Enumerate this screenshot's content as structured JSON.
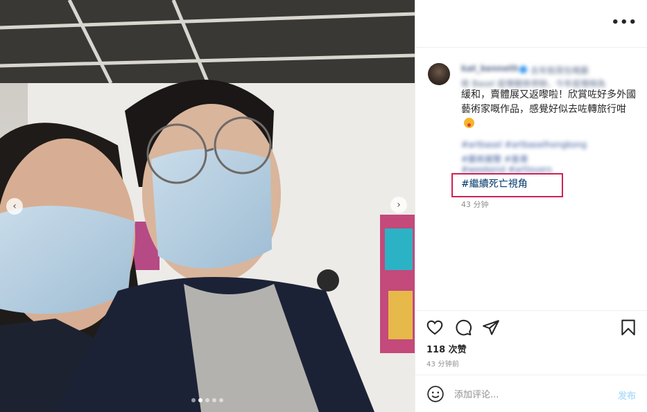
{
  "post": {
    "username": "kat_kenneth",
    "caption_blur_1": "去年既荷包嘅藝",
    "caption_blur_2": "術 Basel 疫情關係停辦，今年疫情稍為",
    "caption_main": "緩和，賣體展又返嚟啦！欣賞咗好多外國藝術家嘅作品，感覺好似去咗轉旅行咁",
    "emoji": "face-with-tongue-icon",
    "tags_blur_1": "#artbasel #artbaselhongkong",
    "tags_blur_2": "#藝術展覽 #香港",
    "tags_blur_3": "#weekend #artlovers",
    "hashtag": "#繼續死亡視角",
    "caption_time": "43 分钟",
    "likes": "118 次赞",
    "post_time": "43 分钟前",
    "more_label": "•••"
  },
  "carousel": {
    "dot_count": 5,
    "active_index": 1,
    "prev_label": "‹",
    "next_label": "›"
  },
  "comment": {
    "placeholder": "添加评论...",
    "post_label": "发布"
  },
  "colors": {
    "highlight": "#d11f55",
    "link": "#00376b",
    "post_disabled": "#b2dffc",
    "verified": "#3897f0"
  }
}
